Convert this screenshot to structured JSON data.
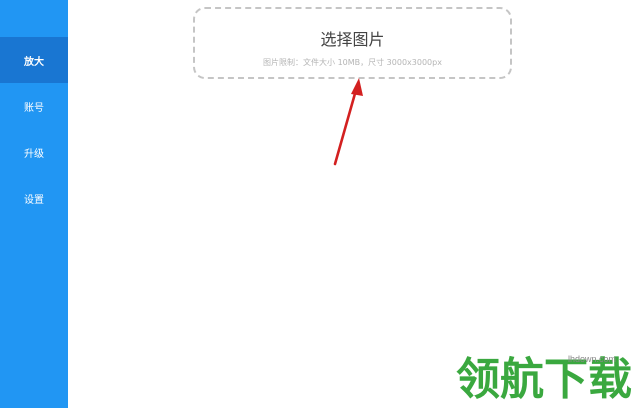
{
  "sidebar": {
    "items": [
      {
        "label": "放大",
        "active": true
      },
      {
        "label": "账号",
        "active": false
      },
      {
        "label": "升级",
        "active": false
      },
      {
        "label": "设置",
        "active": false
      }
    ]
  },
  "upload": {
    "title": "选择图片",
    "hint": "图片限制：文件大小 10MB，尺寸 3000x3000px"
  },
  "watermark": {
    "domain": "lhdown.com",
    "text": "领航下载"
  },
  "colors": {
    "sidebar_bg": "#2196f3",
    "sidebar_active": "#1976d2",
    "arrow": "#d32020",
    "watermark": "#3aa83f"
  }
}
